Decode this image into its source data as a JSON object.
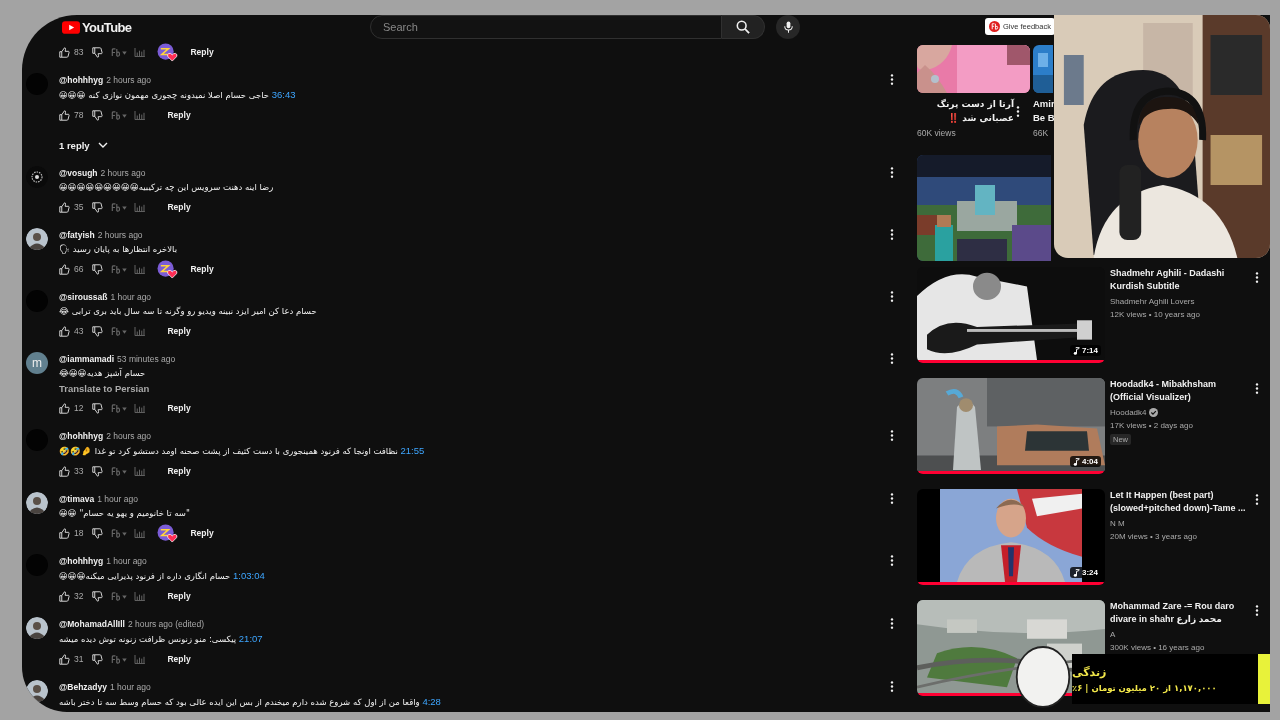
{
  "topbar": {
    "logo": "YouTube",
    "search": {
      "placeholder": "Search"
    }
  },
  "comments": [
    {
      "likes": "83",
      "hearted": true,
      "reply": "Reply"
    },
    {
      "kind": "dark",
      "author": "@hohhhyg",
      "time": "2 hours ago",
      "timestamp": "36:43",
      "text": "حاجی حسام اصلا نمیدونه چجوری مهمون نوازی کنه 😀😀😀",
      "likes": "78",
      "hearted": false,
      "reply": "Reply",
      "replies": "1 reply"
    },
    {
      "kind": "emblem",
      "author": "@vosugh",
      "time": "2 hours ago",
      "text": "رضا اینه دهنت سرویس این چه ترکیبیه😀😀😀😀😀😀😀😀😀",
      "likes": "35",
      "hearted": false,
      "reply": "Reply"
    },
    {
      "author": "@fatyish",
      "time": "2 hours ago",
      "text": "بالاخره انتظارها به پایان رسید 🗣",
      "likes": "66",
      "hearted": true,
      "reply": "Reply"
    },
    {
      "kind": "dark",
      "author": "@siroussaß",
      "time": "1 hour ago",
      "text": "حسام دعا کن امیر ایزد نبینه ویدیو رو وگرنه تا سه سال باید بری ترابی 😂",
      "likes": "43",
      "hearted": false,
      "reply": "Reply"
    },
    {
      "kind": "letter",
      "initial": "m",
      "author": "@iammamadi",
      "time": "53 minutes ago",
      "text": "حسام آشپز هدیه😀😀😂",
      "translate": "Translate to Persian",
      "likes": "12",
      "hearted": false,
      "reply": "Reply"
    },
    {
      "kind": "dark",
      "author": "@hohhhyg",
      "time": "2 hours ago",
      "timestamp": "21:55",
      "text": "نظافت اونجا که فرنود همینجوری با دست کثیف از پشت صحنه اومد دستشو کرد تو غذا 🤌🤣🤣",
      "likes": "33",
      "hearted": false,
      "reply": "Reply"
    },
    {
      "author": "@timava",
      "time": "1 hour ago",
      "text": "\"سه تا خانومیم و یهو یه حسام\" 😀😀",
      "likes": "18",
      "hearted": true,
      "reply": "Reply"
    },
    {
      "kind": "dark",
      "author": "@hohhhyg",
      "time": "1 hour ago",
      "timestamp": "1:03:04",
      "text": "حسام انگاری داره از فرنود پذیرایی میکنه😀😀😀",
      "likes": "32",
      "hearted": false,
      "reply": "Reply"
    },
    {
      "author": "@MohamadAllIll",
      "time": "2 hours ago (edited)",
      "timestamp": "21:07",
      "text": "پیکسی: منو زنونس ظرافت زنونه توش دیده میشه",
      "likes": "31",
      "hearted": false,
      "reply": "Reply"
    },
    {
      "author": "@Behzadyy",
      "time": "1 hour ago",
      "timestamp": "4:28",
      "text": "واقعا من از اول که شروع شده دارم میخندم از بس این ایده عالی بود که حسام وسط سه تا دختر باشه"
    }
  ],
  "feedback": "Give feedback",
  "shelf": [
    {
      "title_lines": [
        "آرتا از دست پرنگ",
        "عصبانی شد ‼️"
      ],
      "views": "60K views"
    },
    {
      "title_lines": [
        "Amir",
        "Be B"
      ],
      "views": "66K"
    }
  ],
  "videos": [
    {
      "kind": "picture"
    },
    {
      "title": "Shadmehr Aghili - Dadashi Kurdish Subtitle",
      "channel": "Shadmehr Aghili Lovers",
      "verified": false,
      "meta": "12K views • 10 years ago",
      "duration": "7:14",
      "level": 1
    },
    {
      "title": "Hoodadk4 - Mibakhsham (Official Visualizer)",
      "channel": "Hoodadk4",
      "verified": true,
      "meta": "17K views • 2 days ago",
      "badge": "New",
      "duration": "4:04",
      "level": 1
    },
    {
      "title": "Let It Happen (best part) (slowed+pitched down)-Tame ...",
      "channel": "N M",
      "verified": false,
      "meta": "20M views • 3 years ago",
      "duration": "3:24",
      "level": 1
    },
    {
      "title": "Mohammad Zare -= Rou daro divare in shahr محمد زارع",
      "channel": "A",
      "verified": false,
      "meta": "300K views • 16 years ago",
      "level": 1
    }
  ],
  "donation": {
    "title": "زندگی",
    "progress": "۱,۱۷۰,۰۰۰ از ۲۰ میلیون تومان | ۶٪",
    "level": 0.06
  }
}
